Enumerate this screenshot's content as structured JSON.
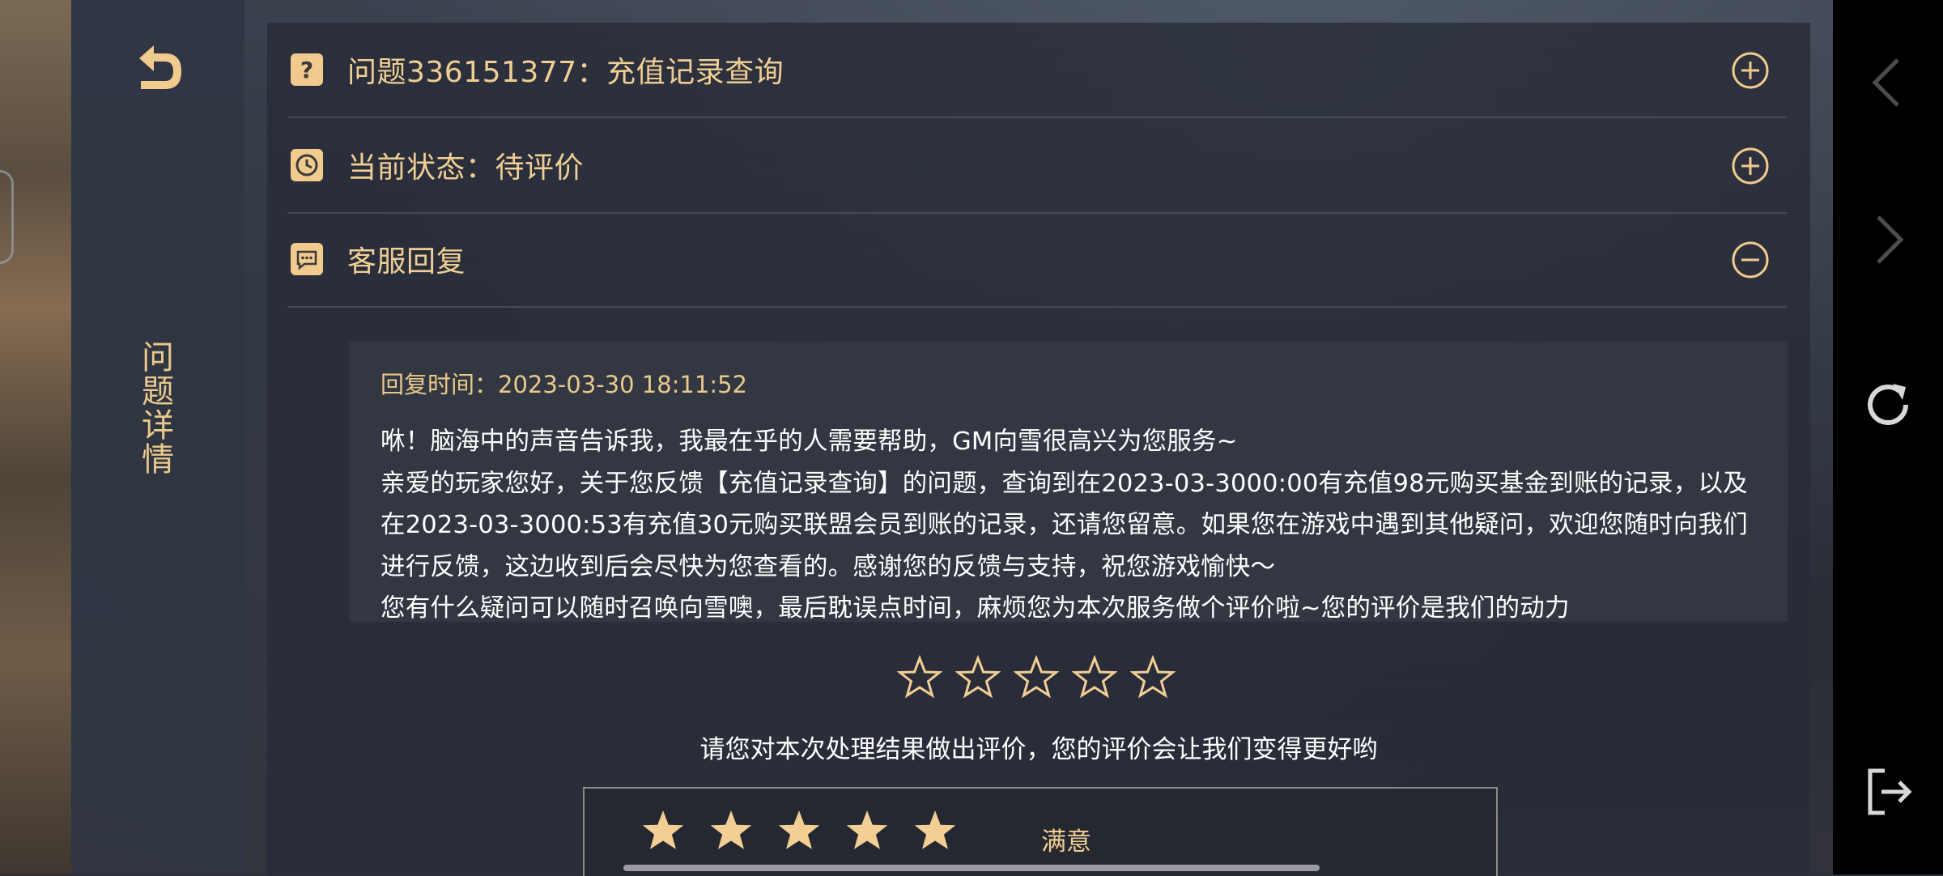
{
  "rail": {
    "title": "问题详情",
    "back_icon": "back-arrow-icon"
  },
  "rows": [
    {
      "icon": "question-icon",
      "label": "问题336151377：充值记录查询",
      "toggle": "plus-icon"
    },
    {
      "icon": "clock-icon",
      "label": "当前状态：待评价",
      "toggle": "plus-icon"
    },
    {
      "icon": "chat-icon",
      "label": "客服回复",
      "toggle": "minus-icon"
    }
  ],
  "reply": {
    "time": "回复时间：2023-03-30 18:11:52",
    "lines": [
      "咻！脑海中的声音告诉我，我最在乎的人需要帮助，GM向雪很高兴为您服务~",
      "亲爱的玩家您好，关于您反馈【充值记录查询】的问题，查询到在2023-03-3000:00有充值98元购买基金到账的记录，以及在2023-03-3000:53有充值30元购买联盟会员到账的记录，还请您留意。如果您在游戏中遇到其他疑问，欢迎您随时向我们进行反馈，这边收到后会尽快为您查看的。感谢您的反馈与支持，祝您游戏愉快～",
      "您有什么疑问可以随时召唤向雪噢，最后耽误点时间，麻烦您为本次服务做个评价啦~您的评价是我们的动力"
    ]
  },
  "rating": {
    "selected": 0,
    "max": 5,
    "prompt": "请您对本次处理结果做出评价，您的评价会让我们变得更好哟",
    "option_stars": 5,
    "option_label": "满意"
  },
  "colors": {
    "accent": "#f0cf94",
    "panel": "#282c38",
    "text": "#ffffff"
  },
  "system_nav": [
    "chevron-left-icon",
    "chevron-right-icon",
    "refresh-icon",
    "exit-icon"
  ]
}
